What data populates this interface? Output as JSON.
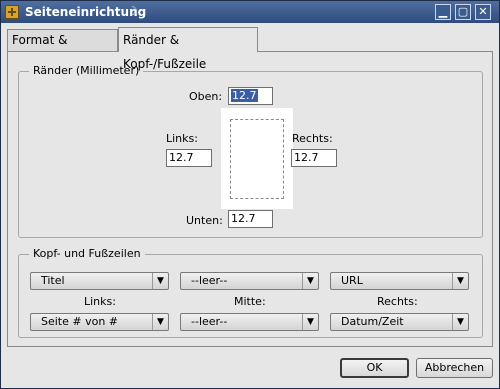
{
  "window": {
    "title": "Seiteneinrichtung",
    "title_glyph": "☽"
  },
  "titlebar_buttons": {
    "minimize": "▁",
    "maximize": "▢",
    "close": "✕"
  },
  "tabs": [
    {
      "label": "Format & Optionen",
      "active": false
    },
    {
      "label": "Ränder & Kopf-/Fußzeile",
      "active": true
    }
  ],
  "margins": {
    "legend": "Ränder (Millimeter)",
    "top_label": "Oben:",
    "top_value": "12.7",
    "left_label": "Links:",
    "left_value": "12.7",
    "right_label": "Rechts:",
    "right_value": "12.7",
    "bottom_label": "Unten:",
    "bottom_value": "12.7"
  },
  "headers_footers": {
    "legend": "Kopf- und Fußzeilen",
    "header_left": "Titel",
    "header_center": "--leer--",
    "header_right": "URL",
    "label_left": "Links:",
    "label_center": "Mitte:",
    "label_right": "Rechts:",
    "footer_left": "Seite # von #",
    "footer_center": "--leer--",
    "footer_right": "Datum/Zeit",
    "arrow": "▼"
  },
  "buttons": {
    "ok": "OK",
    "cancel": "Abbrechen"
  }
}
